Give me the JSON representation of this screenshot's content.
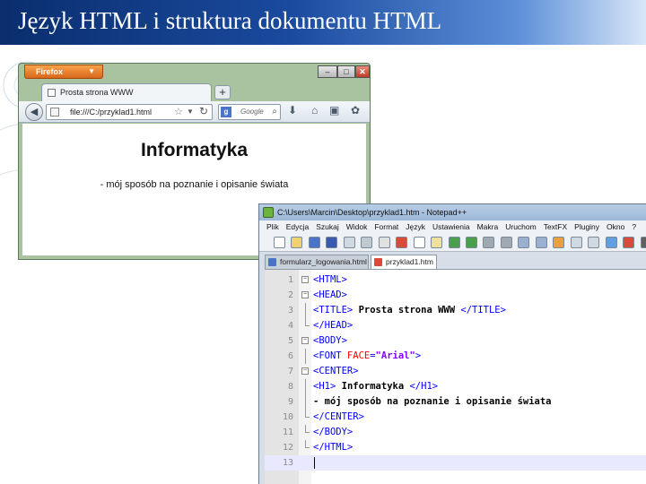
{
  "slide": {
    "title": "Język HTML i struktura dokumentu HTML"
  },
  "firefox": {
    "app_button": "Firefox",
    "tab_title": "Prosta strona WWW",
    "url": "file:///C:/przyklad1.html",
    "search_placeholder": "Google",
    "page": {
      "heading": "Informatyka",
      "text": "- mój sposób na poznanie i opisanie świata"
    }
  },
  "notepad": {
    "title": "C:\\Users\\Marcin\\Desktop\\przyklad1.htm - Notepad++",
    "menu": [
      "Plik",
      "Edycja",
      "Szukaj",
      "Widok",
      "Format",
      "Język",
      "Ustawienia",
      "Makra",
      "Uruchom",
      "TextFX",
      "Pluginy",
      "Okno",
      "?"
    ],
    "tabs": [
      "formularz_logowania.html",
      "przyklad1.htm"
    ],
    "code": {
      "l1": "<HTML>",
      "l2": "<HEAD>",
      "l3_tag_open": "<TITLE>",
      "l3_text": " Prosta strona WWW ",
      "l3_tag_close": "</TITLE>",
      "l4": "</HEAD>",
      "l5": "<BODY>",
      "l6_tag": "<FONT",
      "l6_attr": " FACE",
      "l6_eq": "=",
      "l6_str": "\"Arial\"",
      "l6_end": ">",
      "l7": "<CENTER>",
      "l8_tag_open": "<H1>",
      "l8_text": " Informatyka ",
      "l8_tag_close": "</H1>",
      "l9": "- mój sposób na poznanie i opisanie świata",
      "l10": "</CENTER>",
      "l11": "</BODY>",
      "l12": "</HTML>"
    },
    "line_numbers": [
      "1",
      "2",
      "3",
      "4",
      "5",
      "6",
      "7",
      "8",
      "9",
      "10",
      "11",
      "12",
      "13"
    ]
  }
}
